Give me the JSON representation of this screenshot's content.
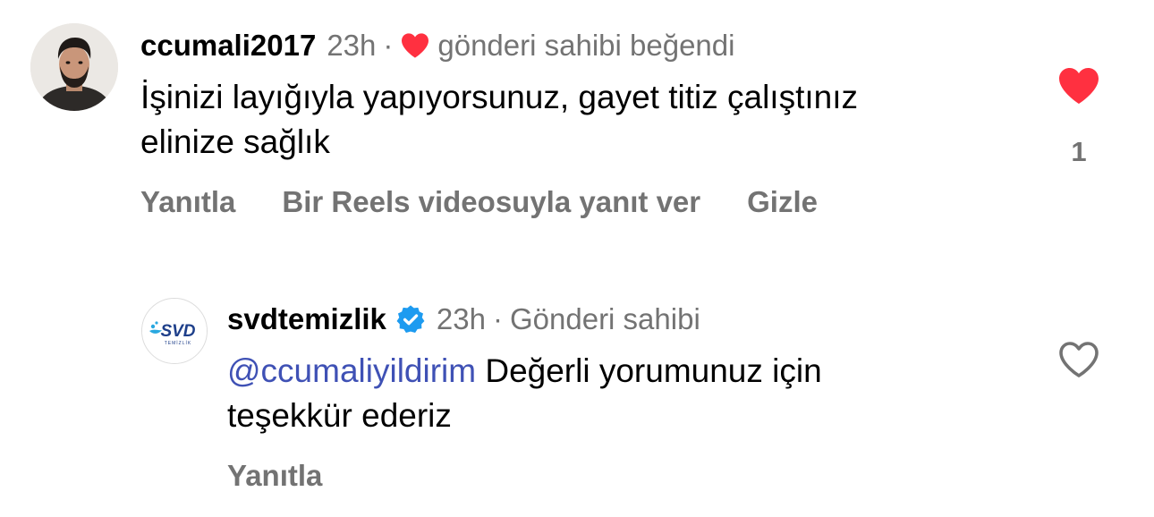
{
  "comments": [
    {
      "username": "ccumali2017",
      "time": "23h",
      "separator": "·",
      "author_liked_text": "gönderi sahibi beğendi",
      "text_line1": "İşinizi layığıyla yapıyorsunuz, gayet titiz çalıştınız",
      "text_line2": "elinize sağlık",
      "actions": {
        "reply": "Yanıtla",
        "reels_reply": "Bir Reels videosuyla yanıt ver",
        "hide": "Gizle"
      },
      "like_count": "1",
      "liked": true
    },
    {
      "username": "svdtemizlik",
      "verified": true,
      "time": "23h",
      "separator": "·",
      "badge": "Gönderi sahibi",
      "mention": "@ccumaliyildirim",
      "text_line1_rest": " Değerli yorumunuz için",
      "text_line2": "teşekkür ederiz",
      "actions": {
        "reply": "Yanıtla"
      },
      "liked": false,
      "avatar_logo_text": "SVD",
      "avatar_logo_subtext": "TEMİZLİK"
    }
  ],
  "colors": {
    "like_red": "#ff3040",
    "muted_gray": "#737373",
    "mention_blue": "#3f51b5",
    "verified_blue": "#1d9bf0"
  }
}
